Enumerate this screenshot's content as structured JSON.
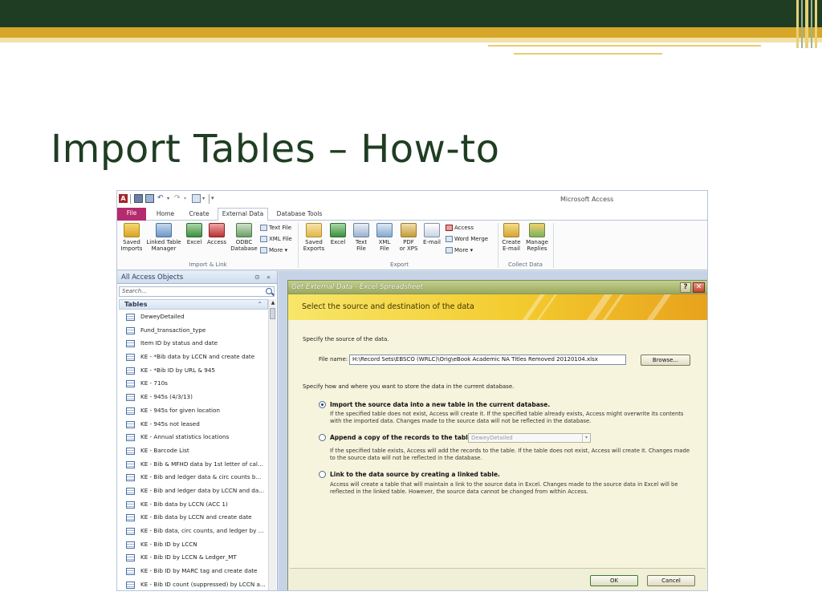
{
  "slide": {
    "title": "Import Tables – How-to"
  },
  "app": {
    "window_title": "Microsoft Access",
    "tabs": [
      "File",
      "Home",
      "Create",
      "External Data",
      "Database Tools"
    ],
    "active_tab": "External Data",
    "ribbon": {
      "import_group": {
        "label": "Import & Link",
        "saved_imports": "Saved\nImports",
        "linked_table_manager": "Linked Table\nManager",
        "excel": "Excel",
        "access": "Access",
        "odbc": "ODBC\nDatabase",
        "text_file": "Text File",
        "xml_file": "XML File",
        "more": "More"
      },
      "export_group": {
        "label": "Export",
        "saved_exports": "Saved\nExports",
        "excel": "Excel",
        "text_file": "Text\nFile",
        "xml_file": "XML\nFile",
        "pdf": "PDF\nor XPS",
        "email": "E-mail",
        "access": "Access",
        "word_merge": "Word Merge",
        "more": "More"
      },
      "collect_group": {
        "label": "Collect Data",
        "create_email": "Create\nE-mail",
        "manage_replies": "Manage\nReplies"
      }
    },
    "nav": {
      "header": "All Access Objects",
      "search_placeholder": "Search...",
      "group": "Tables",
      "items": [
        "DeweyDetailed",
        "Fund_transaction_type",
        "Item ID by status and date",
        "KE - *Bib data by LCCN and create date",
        "KE - *Bib ID by URL & 945",
        "KE - 710s",
        "KE - 945s (4/3/13)",
        "KE - 945s for given location",
        "KE - 945s not leased",
        "KE - Annual statistics locations",
        "KE - Barcode List",
        "KE - Bib & MFHD data by 1st letter of cal...",
        "KE - Bib and ledger data & circ counts b...",
        "KE - Bib and ledger data by LCCN and da...",
        "KE - Bib data by LCCN (ACC 1)",
        "KE - Bib data by LCCN and create date",
        "KE - Bib data, circ counts, and ledger by ...",
        "KE - Bib ID by LCCN",
        "KE - Bib ID by LCCN & Ledger_MT",
        "KE - Bib ID by MARC tag and create date",
        "KE - Bib ID count (suppressed) by LCCN a..."
      ]
    },
    "dialog": {
      "title": "Get External Data - Excel Spreadsheet",
      "heading": "Select the source and destination of the data",
      "source_prompt": "Specify the source of the data.",
      "file_label": "File name:",
      "file_value": "H:\\Record Sets\\EBSCO (WRLC)\\Orig\\eBook Academic NA Titles Removed 20120104.xlsx",
      "browse_label": "Browse...",
      "store_prompt": "Specify how and where you want to store the data in the current database.",
      "options": [
        {
          "title": "Import the source data into a new table in the current database.",
          "desc": "If the specified table does not exist, Access will create it. If the specified table already exists, Access might overwrite its contents with the imported data. Changes made to the source data will not be reflected in the database.",
          "selected": true
        },
        {
          "title": "Append a copy of the records to the table:",
          "desc": "If the specified table exists, Access will add the records to the table. If the table does not exist, Access will create it. Changes made to the source data will not be reflected in the database.",
          "combo_value": "DeweyDetailed",
          "selected": false
        },
        {
          "title": "Link to the data source by creating a linked table.",
          "desc": "Access will create a table that will maintain a link to the source data in Excel. Changes made to the source data in Excel will be reflected in the linked table. However, the source data cannot be changed from within Access.",
          "selected": false
        }
      ],
      "ok_label": "OK",
      "cancel_label": "Cancel"
    }
  }
}
